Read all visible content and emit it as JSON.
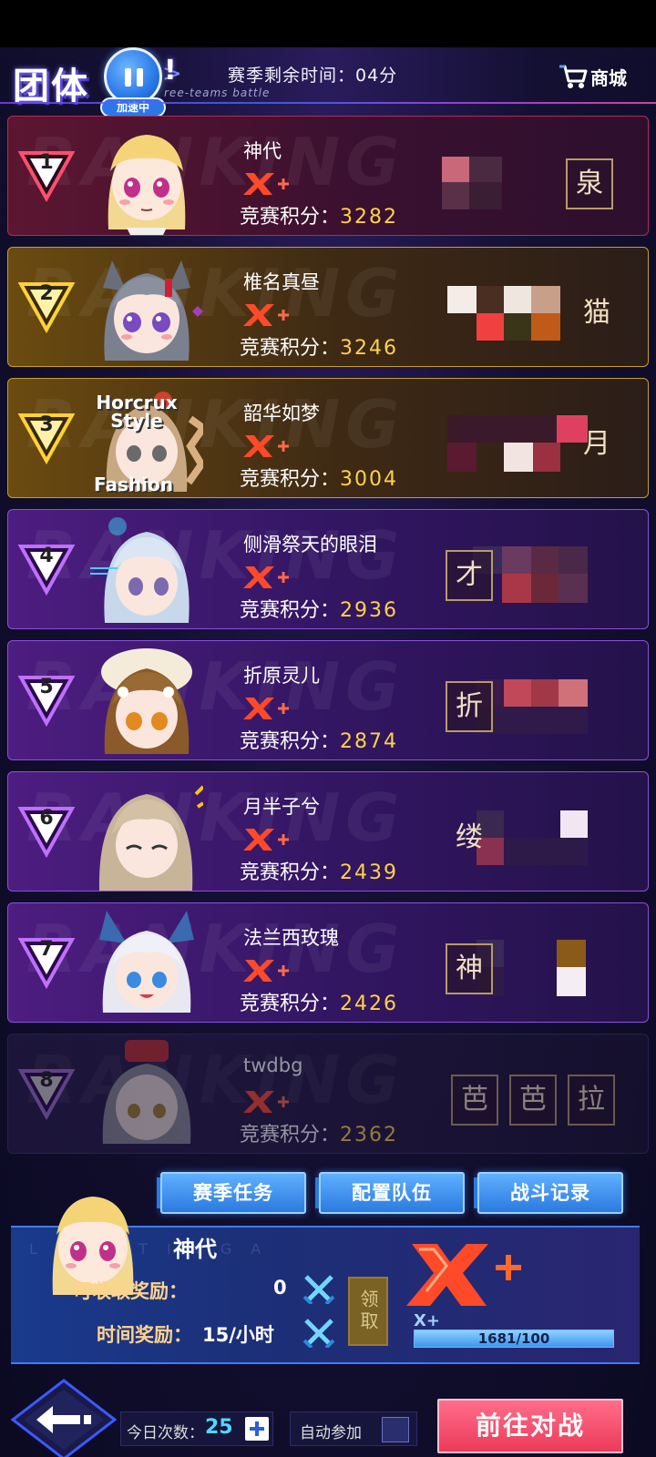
{
  "header": {
    "title": "团体",
    "subtitle": "ree-teams battle",
    "speed_label": "加速中",
    "season_timer": "赛季剩余时间：04分",
    "shop_label": "商城"
  },
  "background_text": "RANKING",
  "rank_tier_label": "X+",
  "score_label": "竞赛积分：",
  "players": [
    {
      "rank": "1",
      "name": "神代",
      "score": "3282",
      "team_chars": [
        "",
        "泉"
      ]
    },
    {
      "rank": "2",
      "name": "椎名真昼",
      "score": "3246",
      "team_chars": [
        "",
        "猫"
      ]
    },
    {
      "rank": "3",
      "name": "韶华如梦",
      "score": "3004",
      "team_chars": [
        "",
        "月"
      ],
      "avatar_text": [
        "Horcrux",
        "Style",
        "Fashion"
      ]
    },
    {
      "rank": "4",
      "name": "侧滑祭天的眼泪",
      "score": "2936",
      "team_chars": [
        "才",
        ""
      ]
    },
    {
      "rank": "5",
      "name": "折原灵儿",
      "score": "2874",
      "team_chars": [
        "折",
        ""
      ]
    },
    {
      "rank": "6",
      "name": "月半子兮",
      "score": "2439",
      "team_chars": [
        "缕",
        ""
      ]
    },
    {
      "rank": "7",
      "name": "法兰西玫瑰",
      "score": "2426",
      "team_chars": [
        "神",
        ""
      ]
    },
    {
      "rank": "8",
      "name": "twdbg",
      "score": "2362",
      "team_chars": [
        "芭",
        "芭",
        "拉"
      ]
    }
  ],
  "buttons": {
    "season_task": "赛季任务",
    "config_team": "配置队伍",
    "battle_record": "战斗记录",
    "claim": "领取",
    "go_battle": "前往对战"
  },
  "my_info": {
    "name": "神代",
    "panel_bg_text": "L S    I N T I N G   A",
    "claimable_label": "可收取奖励：",
    "claimable_value": "0",
    "time_reward_label": "时间奖励：",
    "time_reward_value": "15/小时",
    "tier": "X+",
    "progress_text": "1681/100",
    "progress_fraction": 1.0
  },
  "footer": {
    "today_label": "今日次数：",
    "today_count": "25",
    "auto_label": "自动参加"
  },
  "colors": {
    "score_value": "#ffd24a",
    "tier_red": "#ff4a2a",
    "gold_card": "#c8a020",
    "top_card": "#b5295a",
    "purple_card": "#8b4fe0",
    "go_button": "#ec3a5a",
    "blue_button": "#2b7ae0"
  }
}
